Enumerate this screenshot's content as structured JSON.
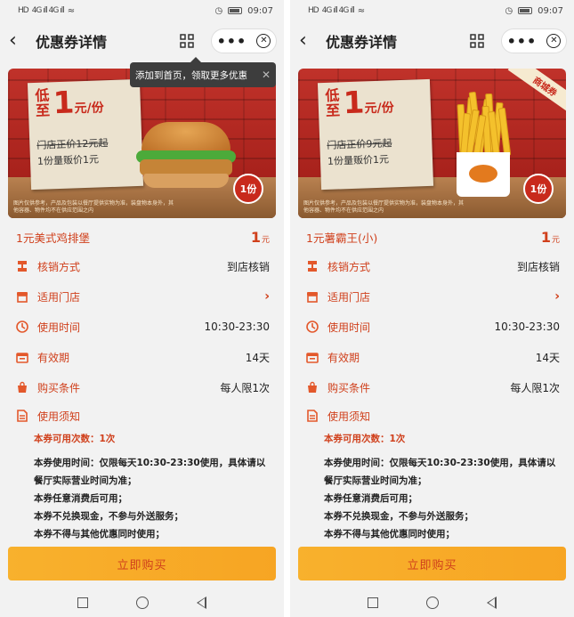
{
  "status": {
    "time": "09:07",
    "net": "HD",
    "signal": "4G ıll 4G ıll"
  },
  "screens": [
    {
      "nav_title": "优惠券详情",
      "tooltip": "添加到首页，领取更多优惠",
      "banner": {
        "low": "低至",
        "price_big": "1",
        "price_unit": "元/份",
        "orig_line": "门店正价12元起",
        "deal_line": "1份量贩价1元",
        "sticker": "1份",
        "corner": "",
        "fine": "图片仅供参考，产品及包装以餐厅提供实物为准，装盘物本身外，其他容器、物件均不在供应范围之内",
        "product": "burger"
      },
      "product_name": "1元美式鸡排堡",
      "price": "1",
      "price_unit": "元",
      "rows": [
        {
          "label": "核销方式",
          "value": "到店核销",
          "icon": "ticket-icon"
        },
        {
          "label": "适用门店",
          "value": "›",
          "icon": "store-icon"
        },
        {
          "label": "使用时间",
          "value": "10:30-23:30",
          "icon": "clock-icon"
        },
        {
          "label": "有效期",
          "value": "14天",
          "icon": "calendar-icon"
        },
        {
          "label": "购买条件",
          "value": "每人限1次",
          "icon": "bag-icon"
        }
      ],
      "notes_label": "使用须知",
      "use_count": "本券可用次数：1次",
      "notes": [
        "本券使用时间：仅限每天10:30-23:30使用，具体请以餐厅实际营业时间为准；",
        "本券任意消费后可用；",
        "本券不兑换现金，不参与外送服务；",
        "本券不得与其他优惠同时使用；"
      ],
      "buy_label": "立即购买"
    },
    {
      "nav_title": "优惠券详情",
      "tooltip": "",
      "banner": {
        "low": "低至",
        "price_big": "1",
        "price_unit": "元/份",
        "orig_line": "门店正价9元起",
        "deal_line": "1份量贩价1元",
        "sticker": "1份",
        "corner": "商城券",
        "fine": "图片仅供参考，产品及包装以餐厅提供实物为准，装盘物本身外，其他容器、物件均不在供应范围之内",
        "product": "fries"
      },
      "product_name": "1元薯霸王(小)",
      "price": "1",
      "price_unit": "元",
      "rows": [
        {
          "label": "核销方式",
          "value": "到店核销",
          "icon": "ticket-icon"
        },
        {
          "label": "适用门店",
          "value": "›",
          "icon": "store-icon"
        },
        {
          "label": "使用时间",
          "value": "10:30-23:30",
          "icon": "clock-icon"
        },
        {
          "label": "有效期",
          "value": "14天",
          "icon": "calendar-icon"
        },
        {
          "label": "购买条件",
          "value": "每人限1次",
          "icon": "bag-icon"
        }
      ],
      "notes_label": "使用须知",
      "use_count": "本券可用次数：1次",
      "notes": [
        "本券使用时间：仅限每天10:30-23:30使用，具体请以餐厅实际营业时间为准；",
        "本券任意消费后可用；",
        "本券不兑换现金，不参与外送服务；",
        "本券不得与其他优惠同时使用；"
      ],
      "buy_label": "立即购买"
    }
  ]
}
